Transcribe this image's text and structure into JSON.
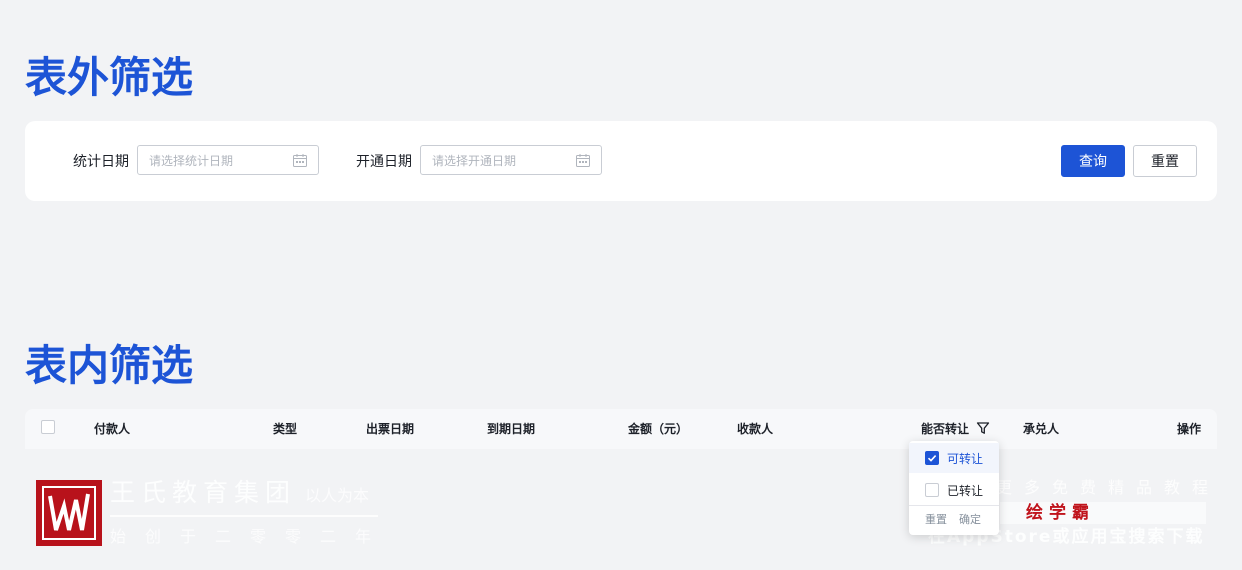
{
  "sections": {
    "outer_title": "表外筛选",
    "inner_title": "表内筛选"
  },
  "filter_bar": {
    "stat_date_label": "统计日期",
    "stat_date_placeholder": "请选择统计日期",
    "open_date_label": "开通日期",
    "open_date_placeholder": "请选择开通日期",
    "query_label": "查询",
    "reset_label": "重置"
  },
  "table": {
    "columns": [
      "付款人",
      "类型",
      "出票日期",
      "到期日期",
      "金额（元）",
      "收款人",
      "能否转让",
      "承兑人",
      "操作"
    ]
  },
  "filter_dropdown": {
    "options": [
      {
        "label": "可转让",
        "checked": true
      },
      {
        "label": "已转让",
        "checked": false
      }
    ],
    "reset_label": "重置",
    "confirm_label": "确定"
  },
  "watermark": {
    "brand": "王氏教育集团",
    "motto": "以人为本",
    "since": "始创于二零零二年",
    "more": "更多免费精品教程",
    "app": "绘学霸",
    "search": "在AppStore或应用宝搜索下载"
  },
  "colors": {
    "accent": "#1d54d6",
    "background": "#f2f3f5",
    "watermark_red": "#b8121b"
  }
}
